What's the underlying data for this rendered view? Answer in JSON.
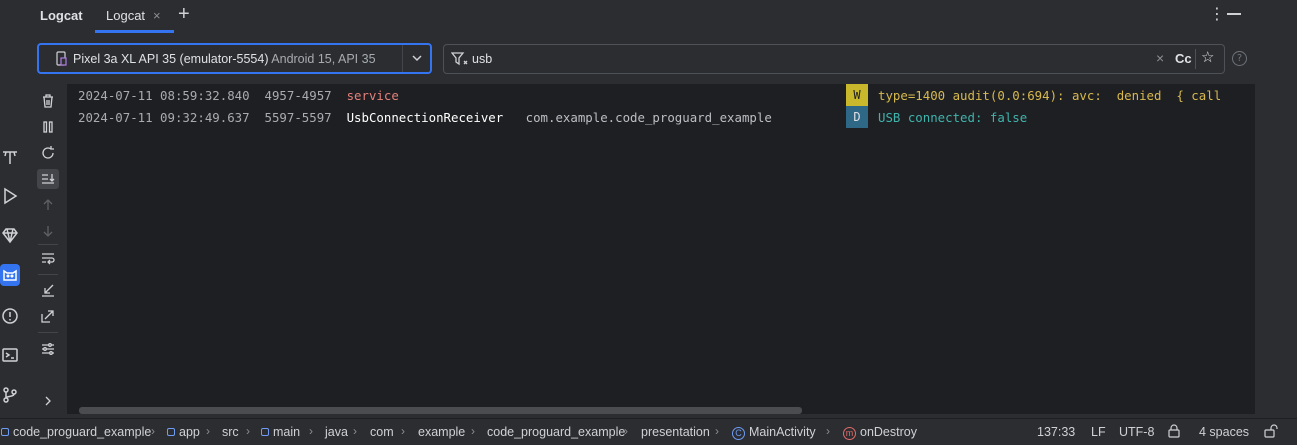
{
  "header": {
    "tool_title": "Logcat",
    "tabs": [
      {
        "label": "Logcat",
        "close": "×"
      }
    ],
    "add_tab": "+",
    "more": "⋮"
  },
  "device_selector": {
    "name": "Pixel 3a XL API 35 (emulator-5554)",
    "detail": "Android 15, API 35"
  },
  "filter": {
    "value": "usb",
    "case_toggle": "Cc",
    "help": "?"
  },
  "logs": [
    {
      "time": "2024-07-11 08:59:32.840",
      "pid": "4957-4957",
      "tag": "service",
      "package": "",
      "level": "W",
      "message": "type=1400 audit(0.0:694): avc:  denied  { call"
    },
    {
      "time": "2024-07-11 09:32:49.637",
      "pid": "5597-5597",
      "tag": "UsbConnectionReceiver",
      "package": "com.example.code_proguard_example",
      "level": "D",
      "message": "USB connected: false"
    }
  ],
  "status_bar": {
    "breadcrumbs": [
      "code_proguard_example",
      "app",
      "src",
      "main",
      "java",
      "com",
      "example",
      "code_proguard_example",
      "presentation",
      "MainActivity",
      "onDestroy"
    ],
    "position": "137:33",
    "line_ending": "LF",
    "encoding": "UTF-8",
    "indent": "4 spaces"
  },
  "colors": {
    "accent": "#3574f0",
    "warn_badge": "#c9b72c",
    "debug_badge": "#2f6787",
    "warn_text": "#d7b94f",
    "debug_text": "#3fb4ad",
    "tag_service": "#e3807a"
  }
}
